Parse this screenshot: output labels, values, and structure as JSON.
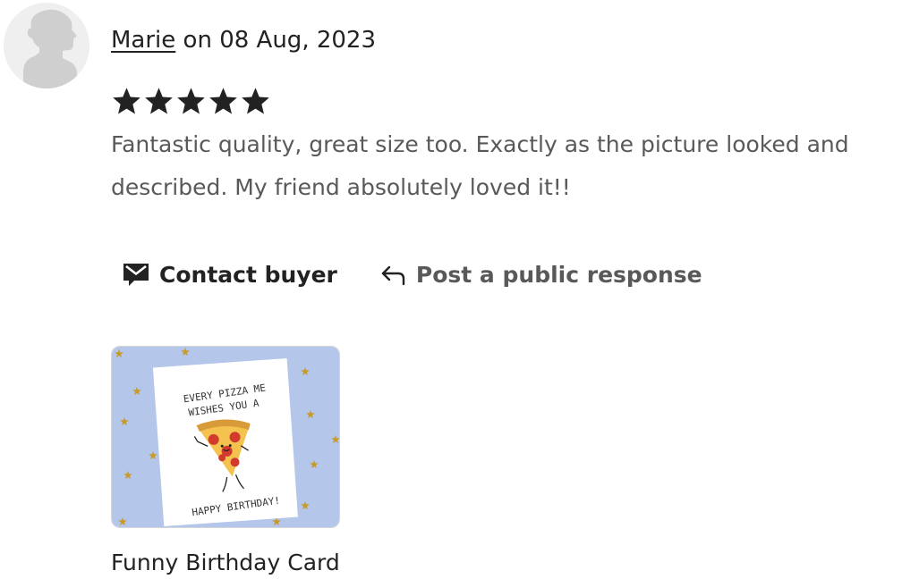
{
  "review": {
    "reviewer_name": "Marie",
    "date_text": "on 08 Aug, 2023",
    "rating": 5,
    "rating_max": 5,
    "body": "Fantastic quality, great size too. Exactly as the picture looked and described. My friend absolutely loved it!!"
  },
  "actions": {
    "contact_label": "Contact buyer",
    "contact_icon": "envelope-icon",
    "respond_label": "Post a public response",
    "respond_icon": "reply-arrow-icon"
  },
  "product": {
    "name": "Funny Birthday Card",
    "card_line_1": "EVERY PIZZA ME",
    "card_line_2": "WISHES YOU A",
    "card_line_3": "HAPPY BIRTHDAY!",
    "background_color": "#b4c6ea",
    "star_color": "#c79a2c"
  },
  "colors": {
    "text_primary": "#222222",
    "text_secondary": "#595959",
    "avatar_bg": "#efefef",
    "avatar_figure": "#cfcfcf"
  }
}
